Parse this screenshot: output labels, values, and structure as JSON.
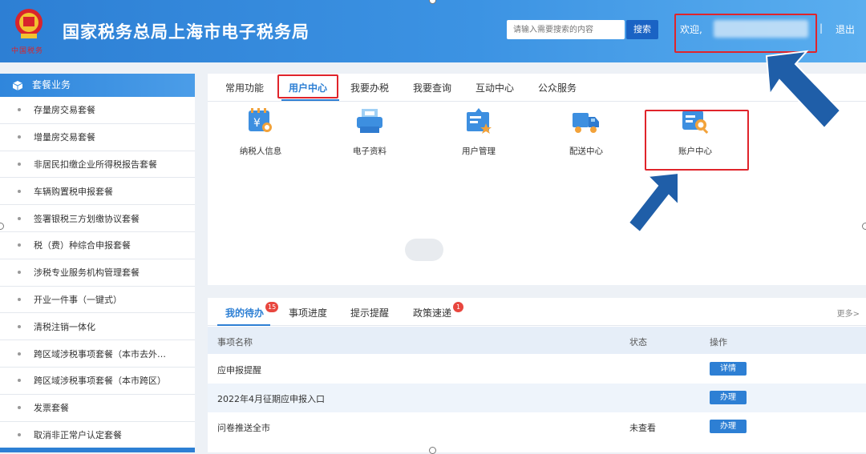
{
  "header": {
    "emblem_caption": "中国税务",
    "title": "国家税务总局上海市电子税务局",
    "search_placeholder": "请输入需要搜索的内容",
    "search_button": "搜索",
    "welcome": "欢迎,",
    "separator": "|",
    "logout": "退出"
  },
  "sidebar": {
    "title": "套餐业务",
    "items": [
      "存量房交易套餐",
      "增量房交易套餐",
      "非居民扣缴企业所得税报告套餐",
      "车辆购置税申报套餐",
      "签署银税三方划缴协议套餐",
      "税（费）种综合申报套餐",
      "涉税专业服务机构管理套餐",
      "开业一件事（一键式）",
      "清税注销一体化",
      "跨区域涉税事项套餐（本市去外…",
      "跨区域涉税事项套餐（本市跨区）",
      "发票套餐",
      "取消非正常户认定套餐"
    ]
  },
  "top_tabs": [
    "常用功能",
    "用户中心",
    "我要办税",
    "我要查询",
    "互动中心",
    "公众服务"
  ],
  "tiles": [
    {
      "label": "纳税人信息",
      "icon": "taxpayer-info-icon"
    },
    {
      "label": "电子资料",
      "icon": "printer-icon"
    },
    {
      "label": "用户管理",
      "icon": "user-management-icon"
    },
    {
      "label": "配送中心",
      "icon": "delivery-truck-icon"
    },
    {
      "label": "账户中心",
      "icon": "account-center-icon"
    }
  ],
  "bottom_tabs": [
    {
      "label": "我的待办",
      "badge": "15"
    },
    {
      "label": "事项进度",
      "badge": ""
    },
    {
      "label": "提示提醒",
      "badge": ""
    },
    {
      "label": "政策速递",
      "badge": "1"
    }
  ],
  "more_link": "更多>",
  "table": {
    "headers": [
      "事项名称",
      "状态",
      "操作"
    ],
    "rows": [
      {
        "name": "应申报提醒",
        "status": "",
        "action": "详情"
      },
      {
        "name": "2022年4月征期应申报入口",
        "status": "",
        "action": "办理"
      },
      {
        "name": "问卷推送全市",
        "status": "未查看",
        "action": "办理"
      }
    ]
  },
  "colors": {
    "header_blue": "#2d7fd4",
    "highlight_red": "#e0242b",
    "arrow_blue": "#1f5ea8",
    "badge_red": "#e8463e"
  }
}
